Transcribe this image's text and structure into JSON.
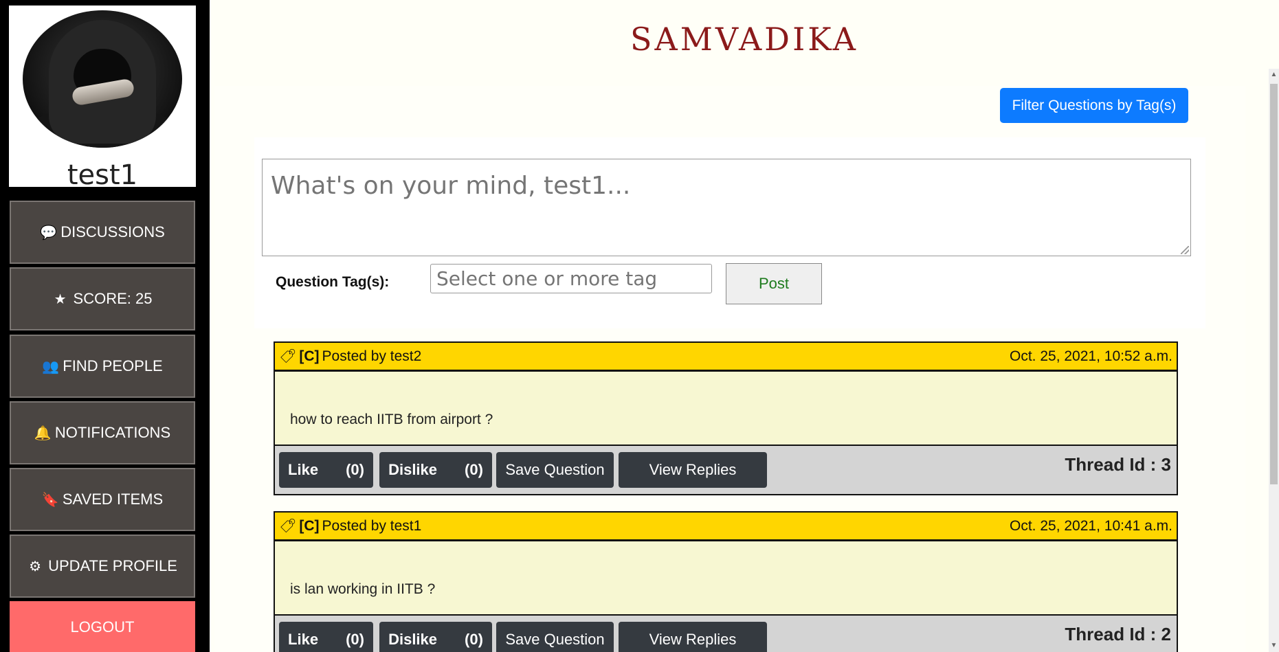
{
  "sidebar": {
    "username": "test1",
    "nav": [
      {
        "label": "DISCUSSIONS",
        "icon": "💬"
      },
      {
        "label": "SCORE: 25",
        "icon": "★"
      },
      {
        "label": "FIND PEOPLE",
        "icon": "👥"
      },
      {
        "label": "NOTIFICATIONS",
        "icon": "🔔"
      },
      {
        "label": "SAVED ITEMS",
        "icon": "🔖"
      },
      {
        "label": "UPDATE PROFILE",
        "icon": "⚙"
      },
      {
        "label": "LOGOUT",
        "icon": ""
      }
    ]
  },
  "header": {
    "title": "SAMVADIKA"
  },
  "toolbar": {
    "filter_label": "Filter Questions by Tag(s)"
  },
  "composer": {
    "placeholder": "What's on your mind, test1...",
    "tags_label": "Question Tag(s):",
    "tags_placeholder": "Select one or more tag",
    "post_label": "Post"
  },
  "threads": [
    {
      "tag": "[C]",
      "posted_by": "Posted by test2",
      "date": "Oct. 25, 2021, 10:52 a.m.",
      "question": "how to reach IITB from airport ?",
      "like_label": "Like",
      "like_count": "(0)",
      "dislike_label": "Dislike",
      "dislike_count": "(0)",
      "save_label": "Save Question",
      "replies_label": "View Replies",
      "thread_id": "Thread Id : 3"
    },
    {
      "tag": "[C]",
      "posted_by": "Posted by test1",
      "date": "Oct. 25, 2021, 10:41 a.m.",
      "question": "is lan working in IITB ?",
      "like_label": "Like",
      "like_count": "(0)",
      "dislike_label": "Dislike",
      "dislike_count": "(0)",
      "save_label": "Save Question",
      "replies_label": "View Replies",
      "thread_id": "Thread Id : 2"
    }
  ],
  "colors": {
    "sidebar_bg": "#000000",
    "nav_bg": "#4a4542",
    "logout_bg": "#ff6a6a",
    "title": "#8b1a1a",
    "filter_btn": "#0d7bff",
    "thread_header": "#ffd600",
    "thread_body": "#f7f7d2",
    "action_btn": "#353a40"
  }
}
